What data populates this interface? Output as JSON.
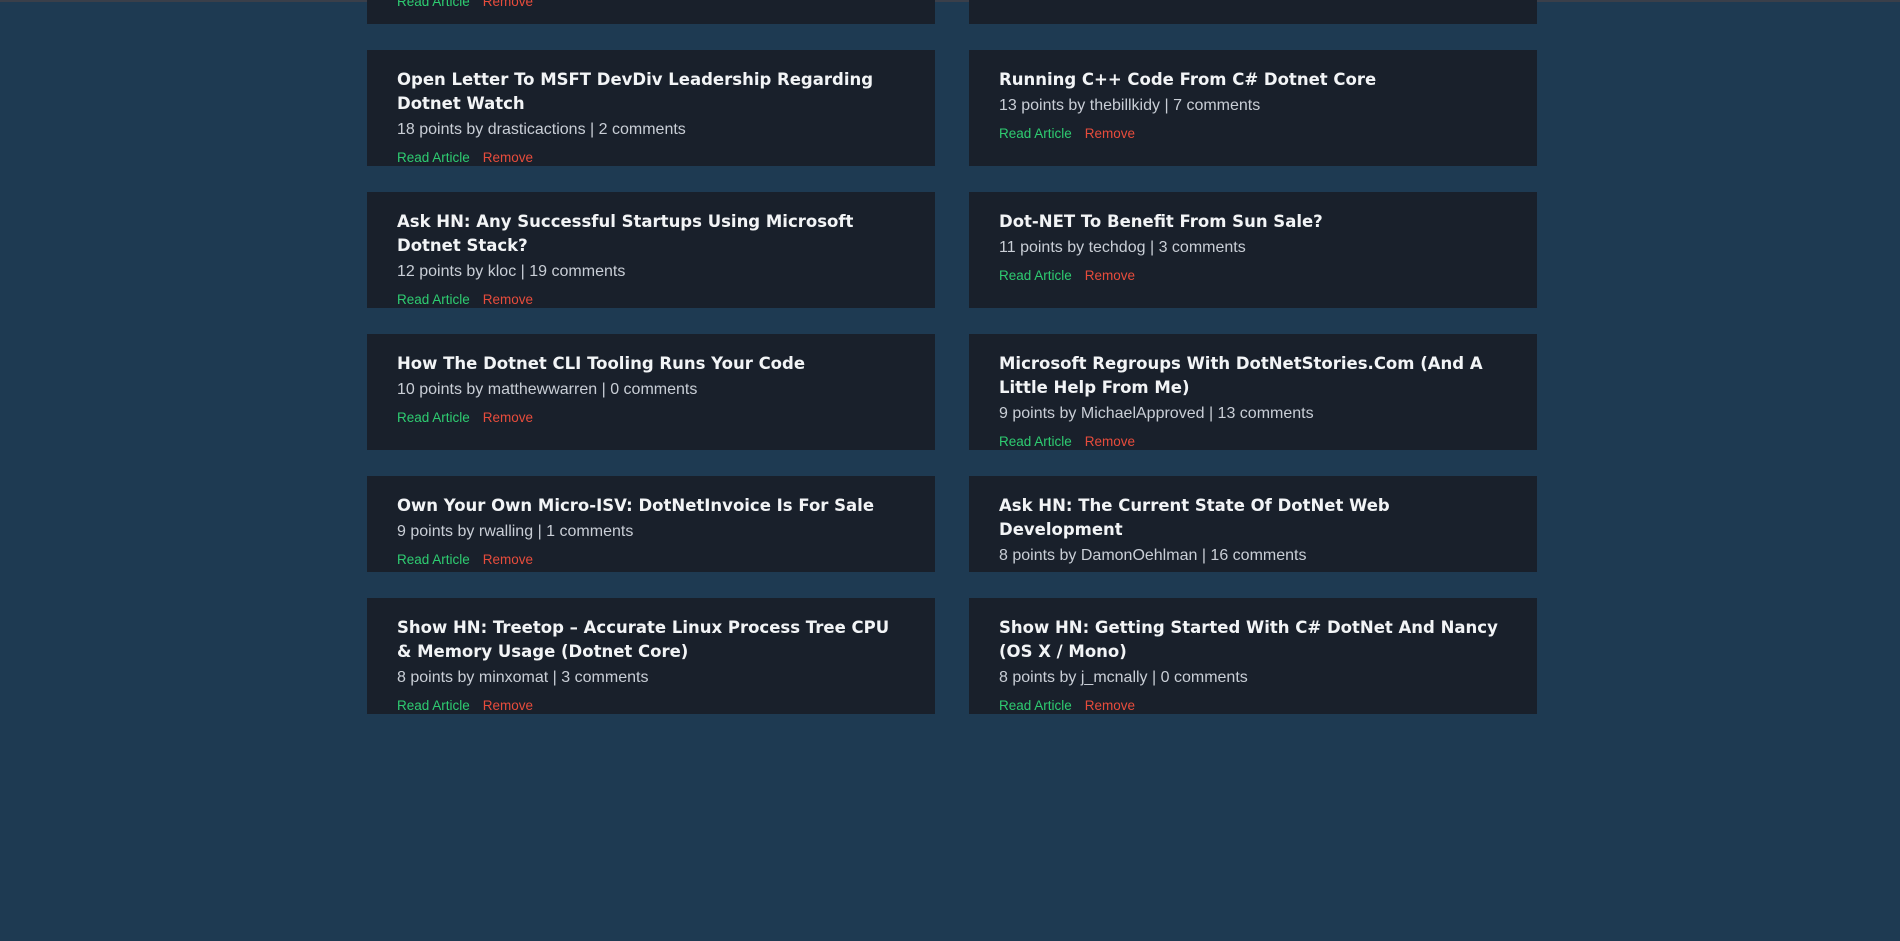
{
  "actions": {
    "read_label": "Read Article",
    "remove_label": "Remove"
  },
  "meta_words": {
    "points": "points by",
    "separator": "|",
    "comments": "comments"
  },
  "articles": [
    {
      "title": "",
      "points": "",
      "author": "",
      "comments": ""
    },
    {
      "title": "",
      "points": "",
      "author": "",
      "comments": ""
    },
    {
      "title": "Open Letter To MSFT DevDiv Leadership Regarding Dotnet Watch",
      "points": "18",
      "author": "drasticactions",
      "comments": "2"
    },
    {
      "title": "Running C++ Code From C# Dotnet Core",
      "points": "13",
      "author": "thebillkidy",
      "comments": "7"
    },
    {
      "title": "Ask HN: Any Successful Startups Using Microsoft Dotnet Stack?",
      "points": "12",
      "author": "kloc",
      "comments": "19"
    },
    {
      "title": "Dot-NET To Benefit From Sun Sale?",
      "points": "11",
      "author": "techdog",
      "comments": "3"
    },
    {
      "title": "How The Dotnet CLI Tooling Runs Your Code",
      "points": "10",
      "author": "matthewwarren",
      "comments": "0"
    },
    {
      "title": "Microsoft Regroups With DotNetStories.Com (And A Little Help From Me)",
      "points": "9",
      "author": "MichaelApproved",
      "comments": "13"
    },
    {
      "title": "Own Your Own Micro-ISV: DotNetInvoice Is For Sale",
      "points": "9",
      "author": "rwalling",
      "comments": "1"
    },
    {
      "title": "Ask HN: The Current State Of DotNet Web Development",
      "points": "8",
      "author": "DamonOehlman",
      "comments": "16"
    },
    {
      "title": "Show HN: Treetop – Accurate Linux Process Tree CPU & Memory Usage (Dotnet Core)",
      "points": "8",
      "author": "minxomat",
      "comments": "3"
    },
    {
      "title": "Show HN: Getting Started With C# DotNet And Nancy (OS X / Mono)",
      "points": "8",
      "author": "j_mcnally",
      "comments": "0"
    }
  ]
}
